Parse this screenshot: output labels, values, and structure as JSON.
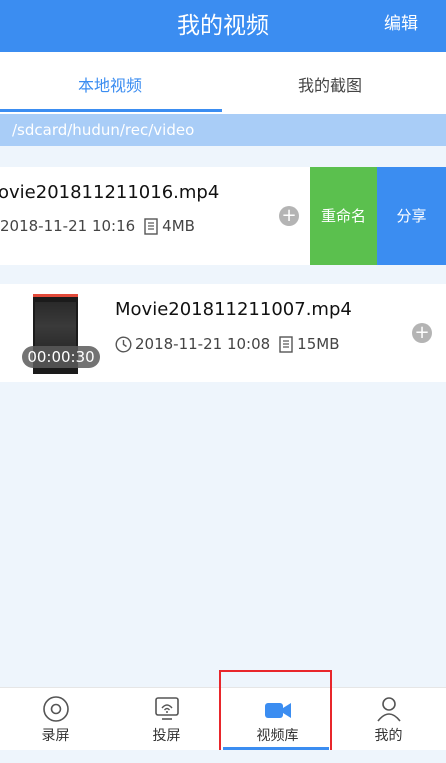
{
  "header": {
    "title": "我的视频",
    "edit_label": "编辑"
  },
  "tabs": [
    {
      "label": "本地视频",
      "active": true
    },
    {
      "label": "我的截图",
      "active": false
    }
  ],
  "path": "/sdcard/hudun/rec/video",
  "videos": [
    {
      "filename": "ovie201811211016.mp4",
      "date": "2018-11-21 10:16",
      "size": "4MB",
      "actions": {
        "rename": "重命名",
        "share": "分享"
      }
    },
    {
      "filename": "Movie201811211007.mp4",
      "date": "2018-11-21 10:08",
      "size": "15MB",
      "duration": "00:00:30"
    }
  ],
  "nav": [
    {
      "label": "录屏",
      "icon": "record-icon"
    },
    {
      "label": "投屏",
      "icon": "cast-icon"
    },
    {
      "label": "视频库",
      "icon": "video-camera-icon",
      "active": true
    },
    {
      "label": "我的",
      "icon": "person-icon"
    }
  ],
  "colors": {
    "primary": "#3b8df1",
    "rename_green": "#5bc04e",
    "path_bar": "#a9cdf7",
    "highlight_red": "#e8262b",
    "background": "#eef5fc"
  }
}
